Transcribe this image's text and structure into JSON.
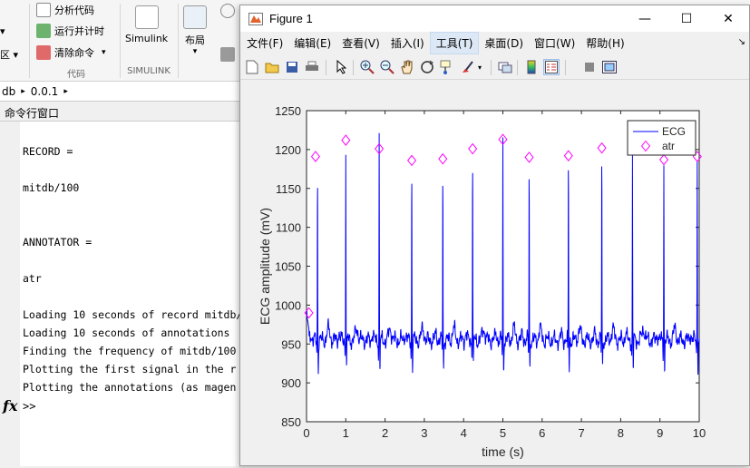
{
  "ribbon": {
    "small_buttons": [
      "分析代码",
      "运行并计时",
      "清除命令"
    ],
    "simulink_label": "Simulink",
    "layout_label": "布局",
    "sections": [
      "代码",
      "SIMULINK"
    ],
    "left_cut_labels": [
      "▾",
      "区 ▾"
    ]
  },
  "address": {
    "part1": "db",
    "part2": "0.0.1"
  },
  "command_window": {
    "title": "命令行窗口",
    "lines": [
      "RECORD =",
      "",
      "mitdb/100",
      "",
      "",
      "ANNOTATOR =",
      "",
      "atr",
      "",
      "Loading 10 seconds of record mitdb/",
      "Loading 10 seconds of annotations",
      "Finding the frequency of mitdb/100",
      "Plotting the first signal in the r",
      "Plotting the annotations (as magen"
    ],
    "fx_label": "fx",
    "prompt": ">>"
  },
  "figure": {
    "title": "Figure 1",
    "window_controls": [
      "—",
      "☐",
      "✕"
    ],
    "menu": [
      "文件(F)",
      "编辑(E)",
      "查看(V)",
      "插入(I)",
      "工具(T)",
      "桌面(D)",
      "窗口(W)",
      "帮助(H)"
    ],
    "active_menu_index": 4,
    "overflow": "↘",
    "toolbar_icons": [
      "new-figure-icon",
      "open-file-icon",
      "save-icon",
      "print-icon",
      "pointer-icon",
      "zoom-in-icon",
      "zoom-out-icon",
      "pan-icon",
      "rotate-icon",
      "data-cursor-icon",
      "brush-icon",
      "link-icon",
      "colorbar-icon",
      "legend-icon",
      "hide-plot-tools-icon",
      "show-plot-tools-icon"
    ]
  },
  "chart_data": {
    "type": "line",
    "title": "",
    "xlabel": "time (s)",
    "ylabel": "ECG amplitude (mV)",
    "xlim": [
      0,
      10
    ],
    "ylim": [
      850,
      1250
    ],
    "xticks": [
      0,
      1,
      2,
      3,
      4,
      5,
      6,
      7,
      8,
      9,
      10
    ],
    "yticks": [
      850,
      900,
      950,
      1000,
      1050,
      1100,
      1150,
      1200,
      1250
    ],
    "grid": false,
    "legend_position": "top-right",
    "series": [
      {
        "name": "ECG",
        "color": "#0000ff",
        "baseline": 955,
        "r_peaks": [
          {
            "t": 0.28,
            "amp": 1175
          },
          {
            "t": 1.0,
            "amp": 1202
          },
          {
            "t": 1.85,
            "amp": 1216
          },
          {
            "t": 2.68,
            "amp": 1180
          },
          {
            "t": 3.47,
            "amp": 1182
          },
          {
            "t": 4.23,
            "amp": 1201
          },
          {
            "t": 5.0,
            "amp": 1212
          },
          {
            "t": 5.67,
            "amp": 1183
          },
          {
            "t": 6.67,
            "amp": 1192
          },
          {
            "t": 7.52,
            "amp": 1200
          },
          {
            "t": 8.3,
            "amp": 1190
          },
          {
            "t": 9.1,
            "amp": 1185
          },
          {
            "t": 9.95,
            "amp": 1192
          }
        ]
      },
      {
        "name": "atr",
        "color": "#ff00ff",
        "marker": "diamond",
        "x": [
          0.06,
          0.23,
          1.0,
          1.85,
          2.68,
          3.47,
          4.23,
          5.0,
          5.67,
          6.67,
          7.52,
          9.1,
          9.95
        ],
        "y": [
          990,
          1191,
          1212,
          1201,
          1186,
          1188,
          1201,
          1213,
          1190,
          1192,
          1202,
          1187,
          1191
        ]
      }
    ]
  }
}
